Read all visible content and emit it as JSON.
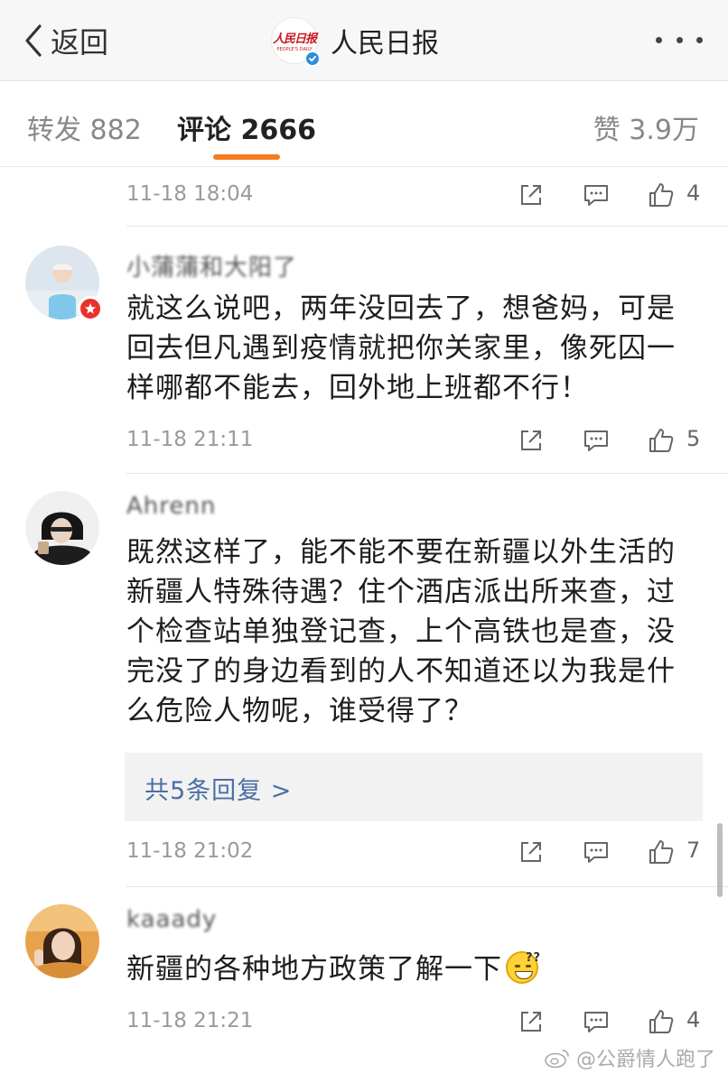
{
  "header": {
    "back_label": "返回",
    "title": "人民日报",
    "logo_text": "人民日报",
    "logo_subtext": "PEOPLE'S DAILY"
  },
  "tabs": {
    "repost": "转发 882",
    "comment": "评论 2666",
    "like": "赞 3.9万"
  },
  "accent_color": "#f57d1f",
  "link_color": "#4a6fa5",
  "comments": [
    {
      "time": "11-18 18:04",
      "likes": "4"
    },
    {
      "username": "小蒲蒲和大阳了",
      "text": "就这么说吧，两年没回去了，想爸妈，可是回去但凡遇到疫情就把你关家里，像死囚一样哪都不能去，回外地上班都不行！",
      "time": "11-18 21:11",
      "likes": "5"
    },
    {
      "username": "Ahrenn",
      "text": "既然这样了，能不能不要在新疆以外生活的新疆人特殊待遇？住个酒店派出所来查，过个检查站单独登记查，上个高铁也是查，没完没了的身边看到的人不知道还以为我是什么危险人物呢，谁受得了？",
      "replies_label": "共5条回复 >",
      "time": "11-18 21:02",
      "likes": "7"
    },
    {
      "username": "kaaady",
      "text": "新疆的各种地方政策了解一下",
      "time": "11-18 21:21",
      "likes": "4"
    }
  ],
  "watermark": "@公爵情人跑了",
  "icons": [
    "chevron-left-icon",
    "verified-icon",
    "more-icon",
    "share-icon",
    "reply-icon",
    "like-icon",
    "weibo-icon",
    "emoji-icon"
  ]
}
